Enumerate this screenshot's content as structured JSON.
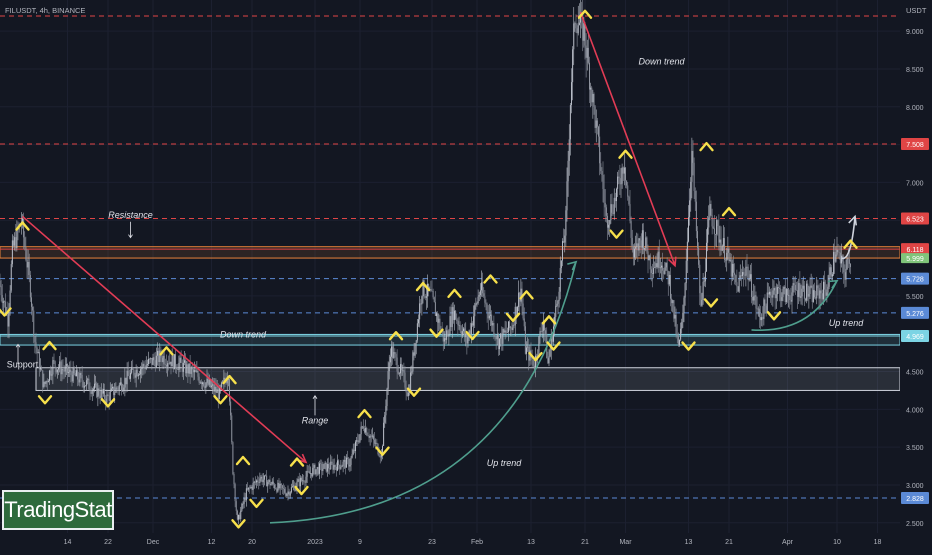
{
  "header": {
    "symbol": "FILUSDT, 4h, BINANCE",
    "currency": "USDT"
  },
  "brand": "TradingStat",
  "colors": {
    "background": "#131722",
    "candle_up": "#b7bcc6",
    "candle_down": "#8e939e",
    "resistance_line": "#e04545",
    "support_line": "#5b8ad6",
    "zone_orange": "#e8823a",
    "zone_white": "#cfd3dc",
    "zone_cyan": "#7cd4e4",
    "arrow_down": "#e23c55",
    "arrow_up": "#4f9e8d",
    "pivot_marker": "#f7e04b",
    "axis_text": "#b2b5be"
  },
  "chart_data": {
    "type": "candlestick",
    "title": "FILUSDT, 4h, BINANCE",
    "ylabel": "USDT",
    "ylim": [
      2.4,
      9.3
    ],
    "yticks": [
      2.5,
      3.0,
      3.5,
      4.0,
      4.5,
      5.0,
      5.5,
      6.0,
      6.5,
      7.0,
      7.5,
      8.0,
      8.5,
      9.0
    ],
    "ytick_labels": [
      "2.500",
      "3.000",
      "3.500",
      "4.000",
      "4.500",
      "5.000",
      "5.500",
      "6.000",
      "6.500",
      "7.000",
      "7.500",
      "8.000",
      "8.500",
      "9.000"
    ],
    "xlim": [
      0,
      200
    ],
    "xticks": [
      {
        "t": 15,
        "label": "14"
      },
      {
        "t": 24,
        "label": "22"
      },
      {
        "t": 34,
        "label": "Dec"
      },
      {
        "t": 47,
        "label": "12"
      },
      {
        "t": 56,
        "label": "20"
      },
      {
        "t": 70,
        "label": "2023"
      },
      {
        "t": 80,
        "label": "9"
      },
      {
        "t": 96,
        "label": "23"
      },
      {
        "t": 106,
        "label": "Feb"
      },
      {
        "t": 118,
        "label": "13"
      },
      {
        "t": 130,
        "label": "21"
      },
      {
        "t": 139,
        "label": "Mar"
      },
      {
        "t": 153,
        "label": "13"
      },
      {
        "t": 162,
        "label": "21"
      },
      {
        "t": 175,
        "label": "Apr"
      },
      {
        "t": 186,
        "label": "10"
      },
      {
        "t": 195,
        "label": "18"
      }
    ],
    "price_path": [
      [
        0,
        5.7
      ],
      [
        2,
        5.2
      ],
      [
        3,
        6.1
      ],
      [
        5,
        6.5
      ],
      [
        7,
        5.6
      ],
      [
        8,
        4.9
      ],
      [
        10,
        4.3
      ],
      [
        12,
        4.6
      ],
      [
        18,
        4.4
      ],
      [
        24,
        4.15
      ],
      [
        30,
        4.5
      ],
      [
        36,
        4.7
      ],
      [
        40,
        4.6
      ],
      [
        44,
        4.45
      ],
      [
        49,
        4.2
      ],
      [
        51,
        4.5
      ],
      [
        52,
        3.2
      ],
      [
        53,
        2.5
      ],
      [
        55,
        2.9
      ],
      [
        58,
        3.1
      ],
      [
        64,
        2.9
      ],
      [
        70,
        3.2
      ],
      [
        78,
        3.3
      ],
      [
        81,
        3.8
      ],
      [
        85,
        3.4
      ],
      [
        87,
        4.8
      ],
      [
        90,
        4.4
      ],
      [
        91,
        4.2
      ],
      [
        94,
        5.6
      ],
      [
        96,
        5.5
      ],
      [
        99,
        4.9
      ],
      [
        101,
        5.3
      ],
      [
        104,
        4.9
      ],
      [
        107,
        5.6
      ],
      [
        111,
        4.9
      ],
      [
        114,
        5.1
      ],
      [
        116,
        5.6
      ],
      [
        117,
        4.8
      ],
      [
        119,
        4.6
      ],
      [
        121,
        5.2
      ],
      [
        122,
        4.6
      ],
      [
        124,
        5.4
      ],
      [
        126,
        6.5
      ],
      [
        127,
        8.1
      ],
      [
        128,
        9.2
      ],
      [
        130,
        9.0
      ],
      [
        133,
        7.6
      ],
      [
        135,
        6.5
      ],
      [
        137,
        6.8
      ],
      [
        139,
        7.3
      ],
      [
        141,
        6.0
      ],
      [
        143,
        6.3
      ],
      [
        145,
        5.9
      ],
      [
        147,
        6.0
      ],
      [
        149,
        5.7
      ],
      [
        151,
        4.8
      ],
      [
        152,
        5.2
      ],
      [
        154,
        7.4
      ],
      [
        156,
        5.3
      ],
      [
        158,
        6.6
      ],
      [
        160,
        6.3
      ],
      [
        162,
        6.0
      ],
      [
        164,
        5.6
      ],
      [
        166,
        5.9
      ],
      [
        169,
        5.2
      ],
      [
        172,
        5.6
      ],
      [
        175,
        5.5
      ],
      [
        178,
        5.6
      ],
      [
        181,
        5.5
      ],
      [
        184,
        5.6
      ],
      [
        186,
        6.1
      ],
      [
        188,
        5.8
      ],
      [
        189,
        6.0
      ]
    ],
    "horizontal_levels": [
      {
        "value": 9.2,
        "style": "dashed",
        "color": "#e04545"
      },
      {
        "value": 7.508,
        "style": "dashed",
        "color": "#e04545",
        "label": "7.508"
      },
      {
        "value": 6.523,
        "style": "dashed",
        "color": "#e04545",
        "label": "6.523"
      },
      {
        "value": 6.118,
        "style": "solid",
        "color": "#e04545",
        "label": "6.118"
      },
      {
        "value": 5.728,
        "style": "dashed",
        "color": "#5b8ad6",
        "label": "5.728"
      },
      {
        "value": 5.276,
        "style": "dashed",
        "color": "#5b8ad6",
        "label": "5.276"
      },
      {
        "value": 4.969,
        "style": "solid",
        "color": "#7cd4e4",
        "label": "4.969"
      },
      {
        "value": 2.828,
        "style": "dashed",
        "color": "#5b8ad6",
        "label": "2.828"
      }
    ],
    "price_marker": {
      "value": 5.999,
      "label": "5.999",
      "color": "#7fc47a"
    },
    "zones": [
      {
        "y0": 6.0,
        "y1": 6.15,
        "color": "#e8823a"
      },
      {
        "y0": 4.85,
        "y1": 4.99,
        "color": "#7cd4e4"
      },
      {
        "y0": 4.25,
        "y1": 4.55,
        "t0": 8,
        "t1": 200,
        "color": "#cfd3dc"
      }
    ],
    "trend_arrows": [
      {
        "kind": "down",
        "from": [
          5,
          6.55
        ],
        "to": [
          68,
          3.3
        ],
        "color": "#e23c55"
      },
      {
        "kind": "down",
        "from": [
          129,
          9.25
        ],
        "to": [
          150,
          5.9
        ],
        "color": "#e23c55"
      },
      {
        "kind": "up",
        "from": [
          60,
          2.5
        ],
        "to": [
          128,
          5.95
        ],
        "color": "#4f9e8d"
      },
      {
        "kind": "up",
        "from": [
          167,
          5.05
        ],
        "to": [
          186,
          5.7
        ],
        "color": "#4f9e8d"
      },
      {
        "kind": "up",
        "from": [
          187,
          6.0
        ],
        "to": [
          190,
          6.55
        ],
        "color": "#cfd3dc"
      }
    ],
    "pivots": [
      {
        "t": 1,
        "p": 5.28,
        "dir": "low"
      },
      {
        "t": 5,
        "p": 6.43,
        "dir": "high"
      },
      {
        "t": 10,
        "p": 4.12,
        "dir": "low"
      },
      {
        "t": 11,
        "p": 4.85,
        "dir": "high"
      },
      {
        "t": 24,
        "p": 4.08,
        "dir": "low"
      },
      {
        "t": 37,
        "p": 4.78,
        "dir": "high"
      },
      {
        "t": 49,
        "p": 4.12,
        "dir": "low"
      },
      {
        "t": 51,
        "p": 4.4,
        "dir": "high"
      },
      {
        "t": 53,
        "p": 2.48,
        "dir": "low"
      },
      {
        "t": 54,
        "p": 3.33,
        "dir": "high"
      },
      {
        "t": 57,
        "p": 2.75,
        "dir": "low"
      },
      {
        "t": 66,
        "p": 3.31,
        "dir": "high"
      },
      {
        "t": 67,
        "p": 2.92,
        "dir": "low"
      },
      {
        "t": 81,
        "p": 3.95,
        "dir": "high"
      },
      {
        "t": 85,
        "p": 3.44,
        "dir": "low"
      },
      {
        "t": 88,
        "p": 4.98,
        "dir": "high"
      },
      {
        "t": 92,
        "p": 4.22,
        "dir": "low"
      },
      {
        "t": 94,
        "p": 5.63,
        "dir": "high"
      },
      {
        "t": 97,
        "p": 5.0,
        "dir": "low"
      },
      {
        "t": 101,
        "p": 5.54,
        "dir": "high"
      },
      {
        "t": 105,
        "p": 4.97,
        "dir": "low"
      },
      {
        "t": 109,
        "p": 5.73,
        "dir": "high"
      },
      {
        "t": 114,
        "p": 5.21,
        "dir": "low"
      },
      {
        "t": 117,
        "p": 5.52,
        "dir": "high"
      },
      {
        "t": 119,
        "p": 4.69,
        "dir": "low"
      },
      {
        "t": 122,
        "p": 5.19,
        "dir": "high"
      },
      {
        "t": 123,
        "p": 4.83,
        "dir": "low"
      },
      {
        "t": 130,
        "p": 9.23,
        "dir": "high"
      },
      {
        "t": 139,
        "p": 7.38,
        "dir": "high"
      },
      {
        "t": 137,
        "p": 6.31,
        "dir": "low"
      },
      {
        "t": 153,
        "p": 4.83,
        "dir": "low"
      },
      {
        "t": 157,
        "p": 7.48,
        "dir": "high"
      },
      {
        "t": 158,
        "p": 5.4,
        "dir": "low"
      },
      {
        "t": 162,
        "p": 6.62,
        "dir": "high"
      },
      {
        "t": 172,
        "p": 5.23,
        "dir": "low"
      },
      {
        "t": 189,
        "p": 6.19,
        "dir": "high"
      }
    ],
    "annotations": [
      {
        "text": "Resistance",
        "t": 29,
        "p": 6.53,
        "italic": true
      },
      {
        "text": "Support",
        "t": 5,
        "p": 4.55,
        "italic": false
      },
      {
        "text": "Down trend",
        "t": 54,
        "p": 4.95,
        "italic": true
      },
      {
        "text": "Range",
        "t": 70,
        "p": 3.81,
        "italic": true
      },
      {
        "text": "Down trend",
        "t": 147,
        "p": 8.56,
        "italic": true
      },
      {
        "text": "Up trend",
        "t": 112,
        "p": 3.25,
        "italic": true
      },
      {
        "text": "Up trend",
        "t": 188,
        "p": 5.1,
        "italic": true
      }
    ]
  }
}
